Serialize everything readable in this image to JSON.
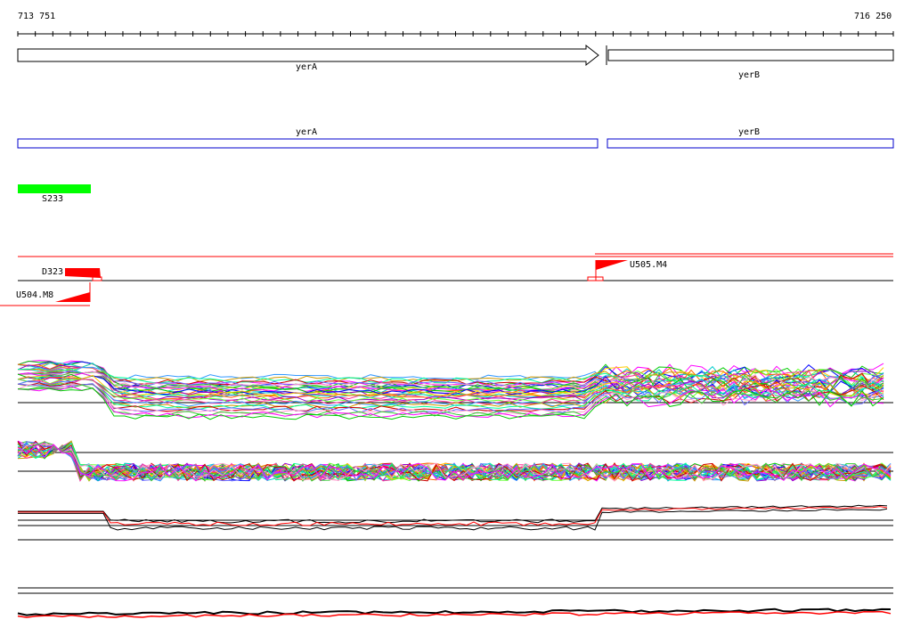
{
  "ruler": {
    "start_label": "713 751",
    "end_label": "716 250"
  },
  "genes_track": {
    "gene_a": "yerA",
    "gene_b": "yerB"
  },
  "cds_track": {
    "cds_a": "yerA",
    "cds_b": "yerB",
    "outline_color": "#0000cc"
  },
  "feature_track": {
    "label": "S233",
    "color": "#00ff00"
  },
  "marker_track": {
    "d_label": "D323",
    "u1_label": "U505.M4",
    "u2_label": "U504.M8",
    "color": "#ff0000"
  },
  "palette": [
    "#ff00ff",
    "#00cc00",
    "#0000ff",
    "#ffcc00",
    "#00cccc",
    "#ff6600",
    "#9900cc",
    "#66ff33",
    "#ff3399",
    "#3399ff",
    "#cc9900",
    "#00ff99",
    "#cc0000",
    "#6666ff",
    "#ff99cc",
    "#33cc33"
  ]
}
